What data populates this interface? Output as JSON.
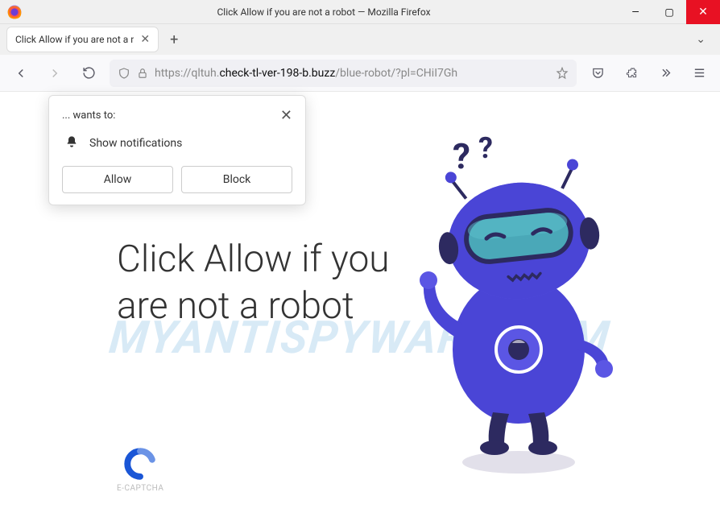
{
  "window": {
    "title": "Click Allow if you are not a robot — Mozilla Firefox"
  },
  "tab": {
    "label": "Click Allow if you are not a r"
  },
  "url": {
    "prefix": "https://qltuh.",
    "domain": "check-tl-ver-198-b.buzz",
    "path": "/blue-robot/?pl=CHiI7Gh"
  },
  "permission": {
    "wants_to": "... wants to:",
    "message": "Show notifications",
    "allow": "Allow",
    "block": "Block"
  },
  "page": {
    "headline": "Click Allow if you are not a robot",
    "captcha_label": "E-CAPTCHA",
    "watermark": "MYANTISPYWARE.COM"
  }
}
